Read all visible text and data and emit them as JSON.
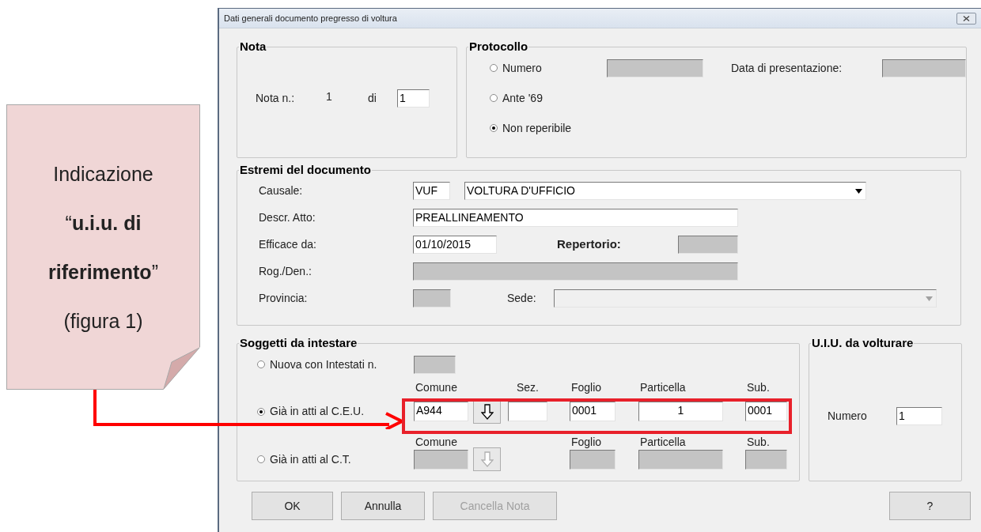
{
  "callout": {
    "text": "Indicazione “**u.i.u. di riferimento**” (figura 1)"
  },
  "dialog": {
    "title": "Dati generali documento pregresso di voltura",
    "nota": {
      "title": "Nota",
      "label": "Nota n.:",
      "number": "1",
      "of_label": "di",
      "total": {
        "value": "1",
        "disabled": false
      }
    },
    "protocollo": {
      "title": "Protocollo",
      "options": [
        {
          "label": "Numero",
          "selected": false
        },
        {
          "label": "Ante '69",
          "selected": false
        },
        {
          "label": "Non reperibile",
          "selected": true
        }
      ],
      "numero_field": {
        "disabled": true
      },
      "date_label": "Data di presentazione:",
      "date_field": {
        "disabled": true
      }
    },
    "estremi": {
      "title": "Estremi del documento",
      "causale_label": "Causale:",
      "causale_code": {
        "value": "VUF",
        "disabled": false
      },
      "causale_value": {
        "value": "VOLTURA D'UFFICIO",
        "disabled": false
      },
      "descr_label": "Descr. Atto:",
      "descr_value": {
        "value": "PREALLINEAMENTO",
        "disabled": false
      },
      "efficace_label": "Efficace da:",
      "efficace_value": {
        "value": "01/10/2015",
        "disabled": false
      },
      "repertorio_label": "Repertorio:",
      "repertorio_value": {
        "disabled": true
      },
      "rog_label": "Rog./Den.:",
      "rog_value": {
        "disabled": true
      },
      "provincia_label": "Provincia:",
      "provincia_value": {
        "disabled": true
      },
      "sede_label": "Sede:",
      "sede_value": {
        "disabled": true
      }
    },
    "soggetti": {
      "title": "Soggetti da intestare",
      "options": [
        {
          "kind": "count",
          "label": "Nuova con Intestati  n.",
          "selected": false,
          "field": {
            "disabled": true
          }
        },
        {
          "kind": "parcel",
          "label": "Già in atti al C.E.U.",
          "selected": true,
          "lookup_disabled": false,
          "fields": [
            {
              "kind": "comune",
              "header": "Comune",
              "value": "A944",
              "disabled": false
            },
            {
              "kind": "sez",
              "header": "Sez.",
              "disabled": false
            },
            {
              "kind": "foglio",
              "header": "Foglio",
              "value": "0001",
              "disabled": false
            },
            {
              "kind": "particella",
              "header": "Particella",
              "value": "1",
              "disabled": false
            },
            {
              "kind": "sub",
              "header": "Sub.",
              "value": "0001",
              "disabled": false
            }
          ]
        },
        {
          "kind": "parcel",
          "label": "Già in atti al C.T.",
          "selected": false,
          "lookup_disabled": true,
          "fields": [
            {
              "kind": "comune",
              "header": "Comune",
              "disabled": true
            },
            {
              "kind": "foglio",
              "header": "Foglio",
              "disabled": true
            },
            {
              "kind": "particella",
              "header": "Particella",
              "disabled": true
            },
            {
              "kind": "sub",
              "header": "Sub.",
              "disabled": true
            }
          ]
        }
      ]
    },
    "uiu": {
      "title": "U.I.U. da volturare",
      "label": "Numero",
      "field": {
        "value": "1",
        "disabled": false
      }
    },
    "buttons": [
      {
        "label": "OK",
        "disabled": false
      },
      {
        "label": "Annulla",
        "disabled": false
      },
      {
        "label": "Cancella Nota",
        "disabled": true
      },
      {
        "label": "?",
        "disabled": false
      }
    ]
  }
}
